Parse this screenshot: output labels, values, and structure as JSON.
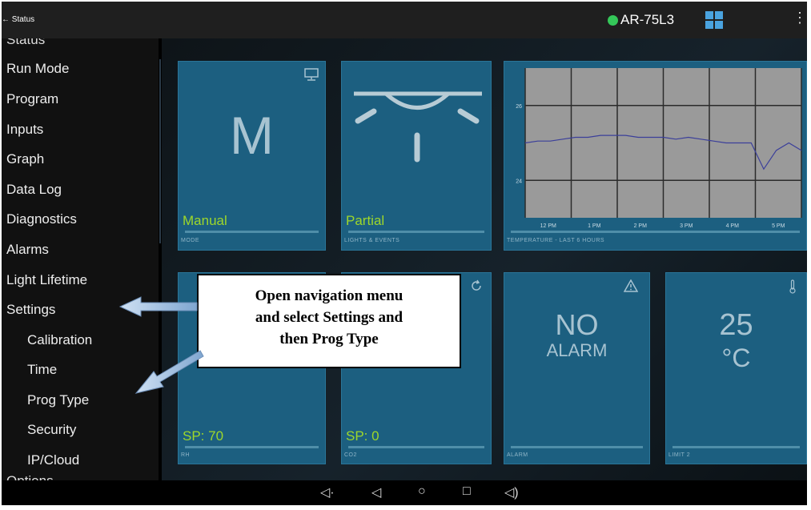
{
  "topbar": {
    "back_label": "← Status",
    "device_name": "AR-75L3",
    "status_color": "#34c759",
    "grid_icon": "grid-icon",
    "menu_icon": "more-vertical-icon"
  },
  "sidebar": {
    "clipped_top": "Status",
    "items": [
      "Run Mode",
      "Program",
      "Inputs",
      "Graph",
      "Data Log",
      "Diagnostics",
      "Alarms",
      "Light Lifetime",
      "Settings"
    ],
    "sub_items": [
      "Calibration",
      "Time",
      "Prog Type",
      "Security",
      "IP/Cloud"
    ],
    "clipped_bottom": "Options"
  },
  "tiles": {
    "mode": {
      "big": "M",
      "value": "Manual",
      "label": "MODE",
      "icon": "monitor-icon"
    },
    "lights": {
      "value": "Partial",
      "label": "LIGHTS & EVENTS",
      "icon": "lamp-icon"
    },
    "temp_chart": {
      "label": "TEMPERATURE - LAST 6 HOURS",
      "chart_data": {
        "type": "line",
        "x": [
          "12 PM",
          "1 PM",
          "2 PM",
          "3 PM",
          "4 PM",
          "5 PM"
        ],
        "y_ticks": [
          24,
          26
        ],
        "ylim": [
          23,
          27
        ],
        "series": [
          {
            "values": [
              25.0,
              25.05,
              25.05,
              25.1,
              25.15,
              25.15,
              25.2,
              25.2,
              25.2,
              25.15,
              25.15,
              25.15,
              25.1,
              25.15,
              25.1,
              25.05,
              25.0,
              25.0,
              25.0,
              24.3,
              24.8,
              25.0,
              24.8
            ]
          }
        ],
        "grid": true
      }
    },
    "rh": {
      "value": "SP: 70",
      "label": "RH"
    },
    "co2": {
      "value": "SP: 0",
      "label": "CO2",
      "icon": "refresh-icon"
    },
    "alarm": {
      "line1": "NO",
      "line2": "ALARM",
      "label": "ALARM",
      "icon": "warning-icon"
    },
    "limit2": {
      "line1": "25",
      "line2": "°C",
      "label": "LIMIT 2",
      "icon": "thermometer-icon"
    }
  },
  "callout": {
    "lines": [
      "Open navigation menu",
      "and select Settings and",
      "then Prog Type"
    ]
  },
  "navbar": {
    "icons": [
      "volume-down-icon",
      "back-icon",
      "home-icon",
      "recents-icon",
      "volume-up-icon"
    ]
  }
}
